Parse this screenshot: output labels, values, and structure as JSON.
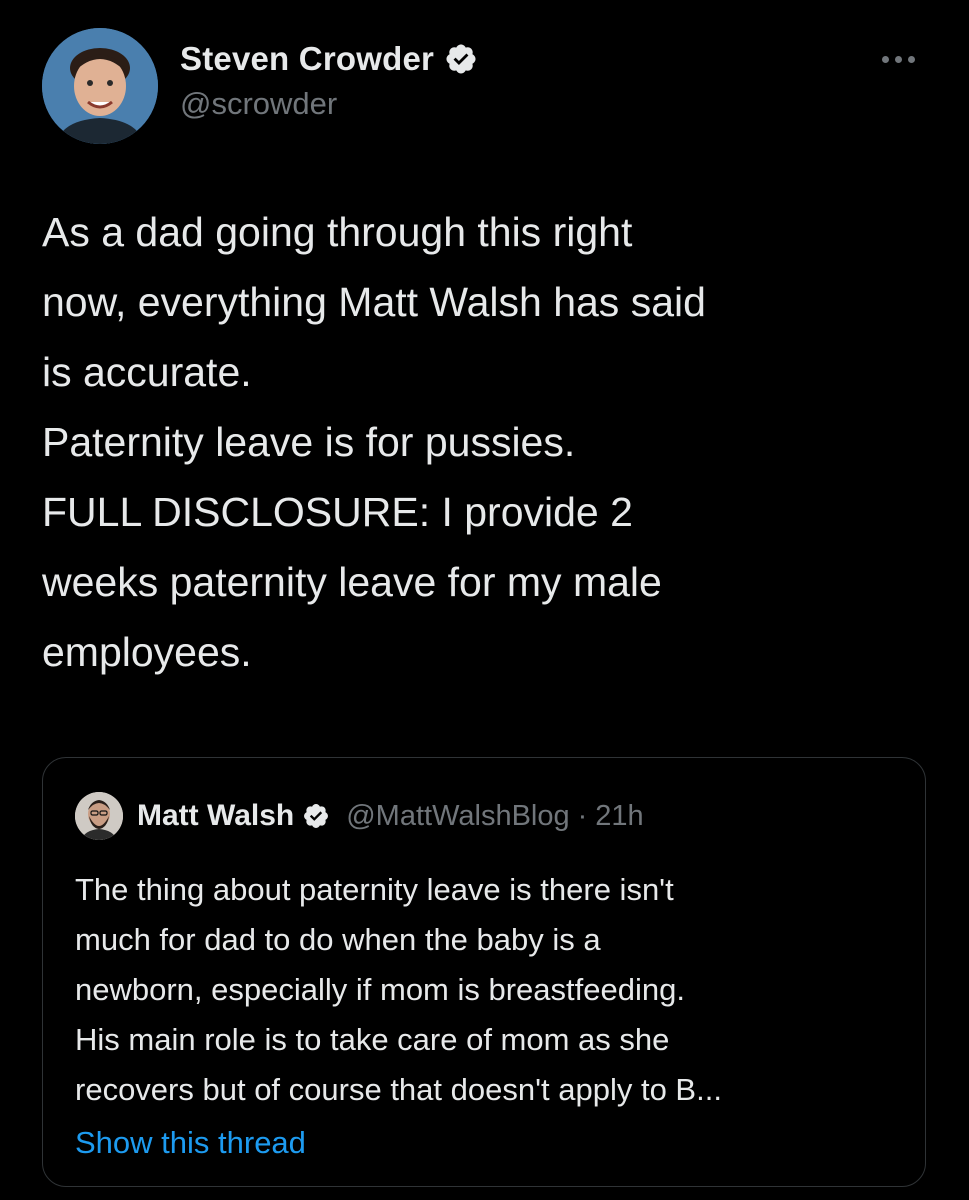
{
  "tweet": {
    "author": {
      "display_name": "Steven Crowder",
      "handle": "@scrowder",
      "verified": true,
      "avatar_icon": "profile-photo"
    },
    "more_icon": "ellipsis-icon",
    "text": "As a dad going through this right\nnow, everything Matt Walsh has said\nis accurate.\nPaternity leave is for pussies.\nFULL DISCLOSURE: I provide 2\nweeks paternity leave for my male\nemployees."
  },
  "quoted_tweet": {
    "author": {
      "display_name": "Matt Walsh",
      "handle": "@MattWalshBlog",
      "verified": true,
      "avatar_icon": "profile-photo"
    },
    "separator": "·",
    "time": "21h",
    "text": "The thing about paternity leave is there isn't\nmuch for dad to do when the baby is a\nnewborn, especially if mom is breastfeeding.\nHis main role is to take care of mom as she\nrecovers but of course that doesn't apply to B...",
    "show_thread_label": "Show this thread"
  },
  "colors": {
    "background": "#000000",
    "text_primary": "#e7e9ea",
    "text_secondary": "#71767b",
    "link": "#1d9bf0",
    "border": "#2f3336",
    "verified_badge": "#e7e9ea"
  }
}
